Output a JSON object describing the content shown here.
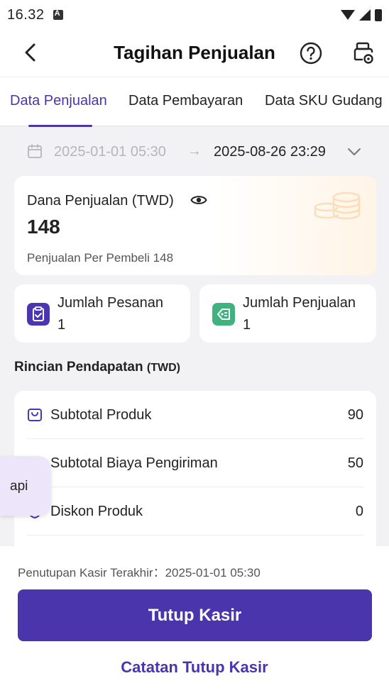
{
  "status_bar": {
    "time": "16.32"
  },
  "header": {
    "title": "Tagihan Penjualan"
  },
  "tabs": [
    {
      "label": "Data Penjualan",
      "active": true
    },
    {
      "label": "Data Pembayaran",
      "active": false
    },
    {
      "label": "Data SKU Gudang",
      "active": false
    }
  ],
  "date_range": {
    "start": "2025-01-01 05:30",
    "arrow": "→",
    "end": "2025-08-26 23:29"
  },
  "sales_card": {
    "label": "Dana Penjualan (TWD)",
    "value": "148",
    "sub": "Penjualan Per Pembeli 148"
  },
  "stats": [
    {
      "label": "Jumlah Pesanan",
      "value": "1",
      "icon": "clipboard-check-icon",
      "color": "#4b35b1"
    },
    {
      "label": "Jumlah Penjualan",
      "value": "1",
      "icon": "tag-icon",
      "color": "#3fb27f"
    }
  ],
  "income_section": {
    "title": "Rincian Pendapatan",
    "unit": "(TWD)"
  },
  "income_rows": [
    {
      "label": "Subtotal Produk",
      "value": "90",
      "icon": "bag-icon"
    },
    {
      "label": "Subtotal Biaya Pengiriman",
      "value": "50",
      "icon": "truck-icon"
    },
    {
      "label": "Diskon Produk",
      "value": "0",
      "icon": "discount-icon"
    }
  ],
  "floating": {
    "label": "api"
  },
  "footer": {
    "last_close": "Penutupan Kasir Terakhir：2025-01-01 05:30",
    "close_button": "Tutup Kasir",
    "log_link": "Catatan Tutup Kasir"
  },
  "colors": {
    "accent": "#4a35ac",
    "green": "#3fb27f"
  }
}
